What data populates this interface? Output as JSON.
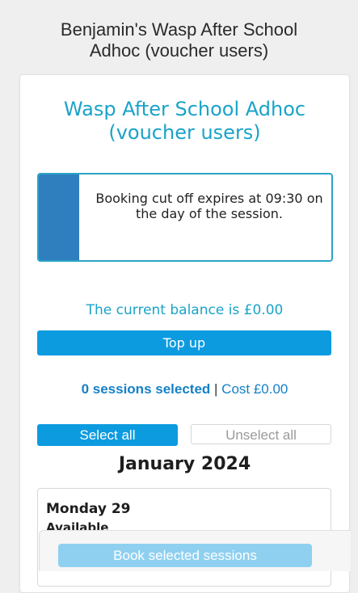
{
  "header": {
    "title": "Benjamin's Wasp After School Adhoc (voucher users)"
  },
  "card": {
    "title": "Wasp After School Adhoc (voucher users)",
    "notice": "Booking cut off expires at 09:30 on the day of the session.",
    "balance_text": "The current balance is £0.00",
    "topup_label": "Top up",
    "sessions": {
      "count_text": "0 sessions selected",
      "separator": " | ",
      "cost_text": "Cost £0.00"
    },
    "select_all_label": "Select all",
    "unselect_all_label": "Unselect all",
    "month": "January 2024",
    "days": [
      {
        "name": "Monday 29",
        "status": "Available"
      }
    ]
  },
  "footer": {
    "book_label": "Book selected sessions"
  },
  "colors": {
    "accent": "#1aa3c8",
    "button": "#0d9be0",
    "notice_bar": "#2f7fbe",
    "book_disabled": "#8fd0f0"
  }
}
